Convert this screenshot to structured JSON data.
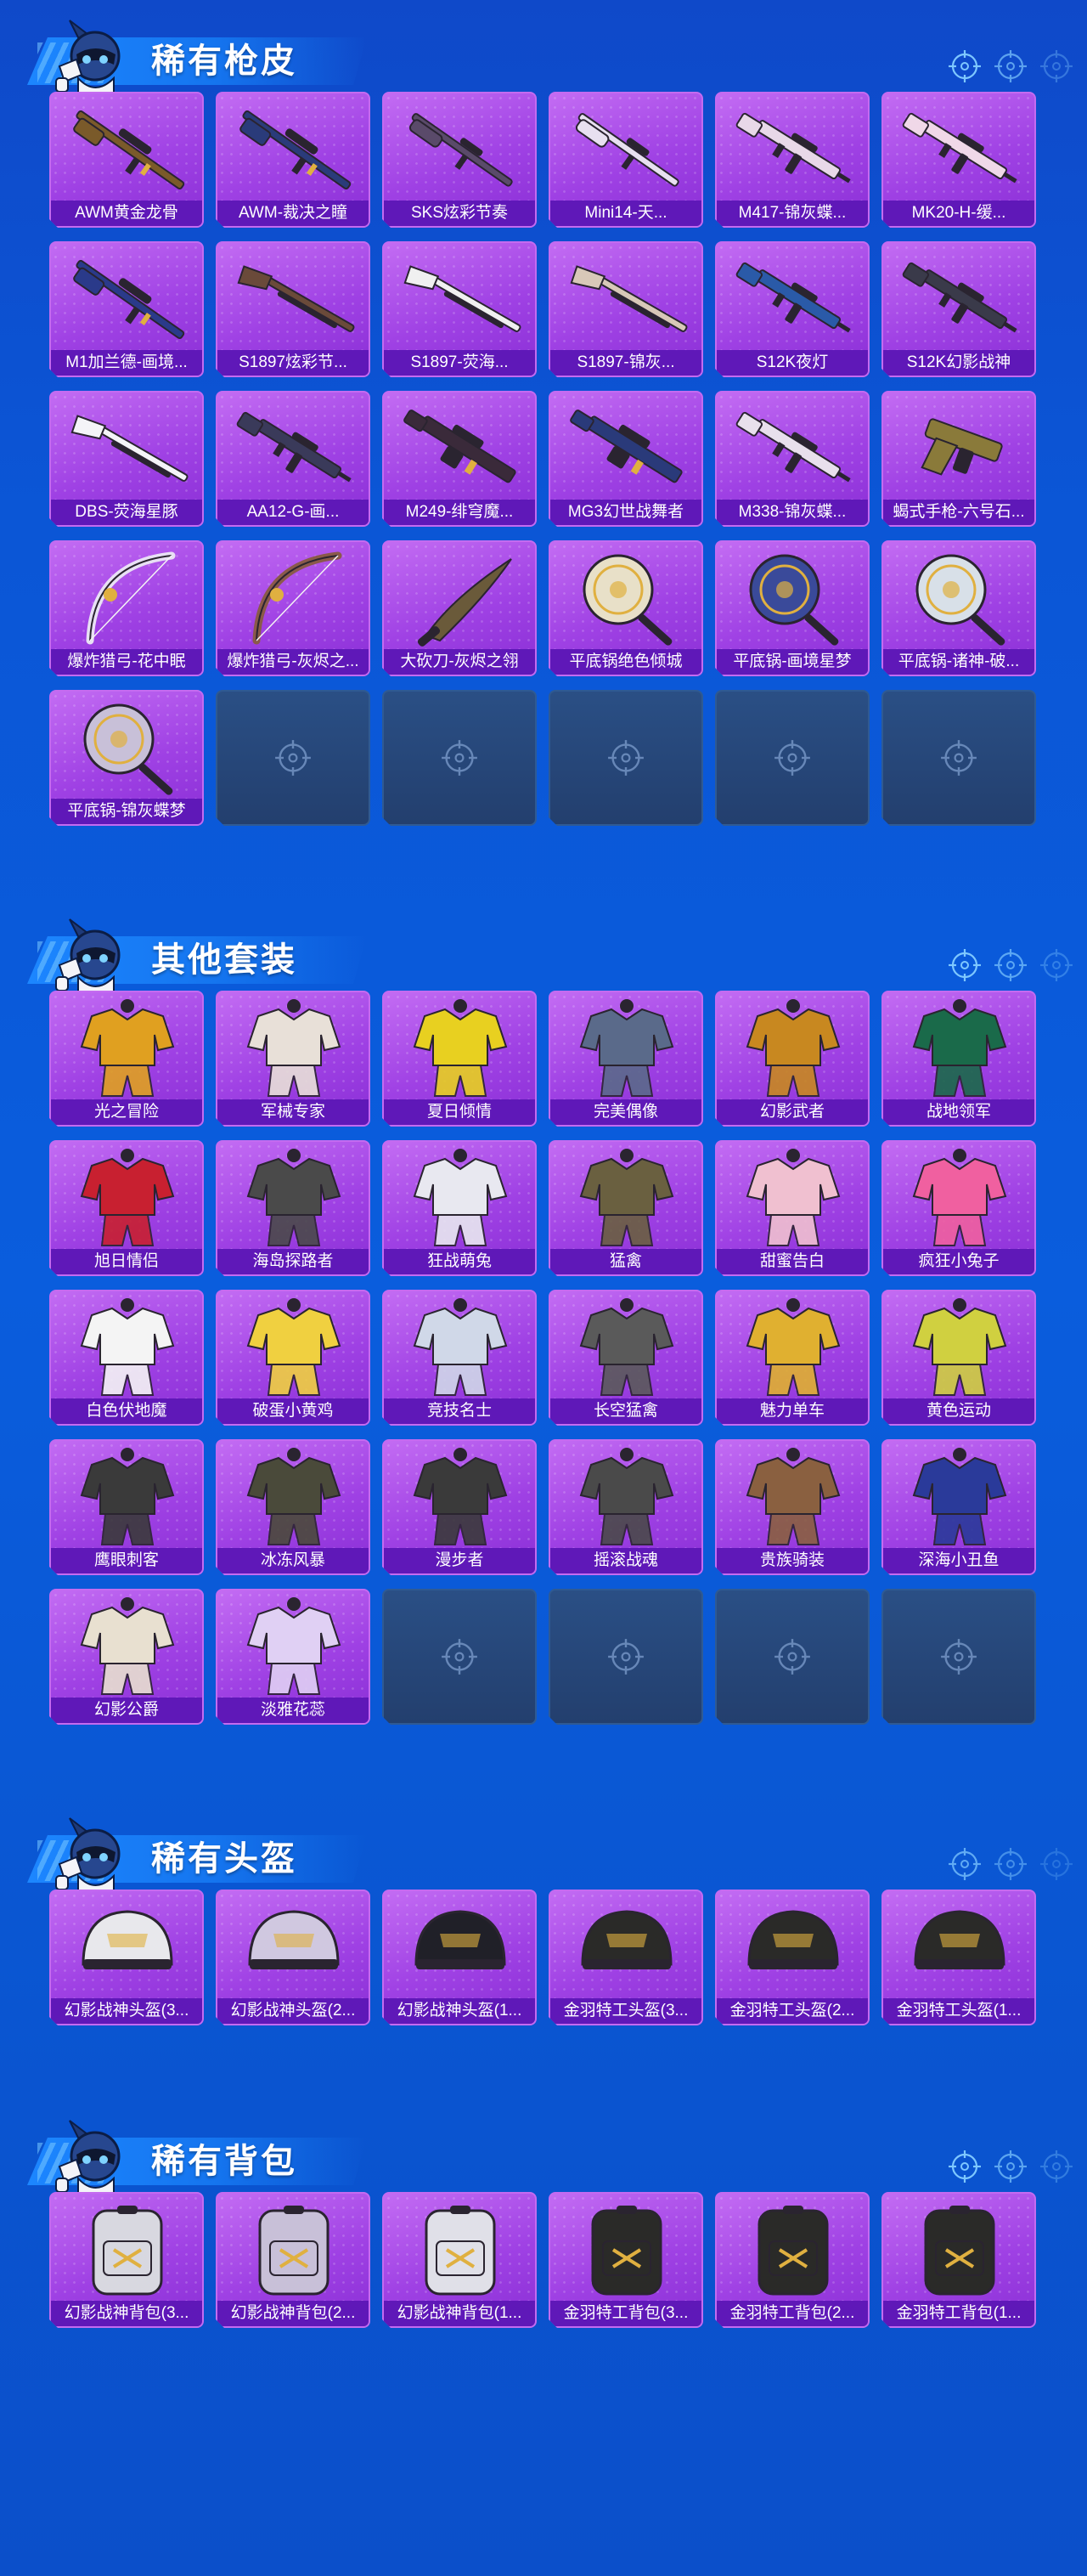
{
  "sections": [
    {
      "title": "稀有枪皮",
      "items": [
        {
          "label": "AWM黄金龙骨",
          "icon": "sniper-rifle",
          "tint": "#7a5a2a"
        },
        {
          "label": "AWM-裁决之瞳",
          "icon": "sniper-rifle",
          "tint": "#2a3b7a"
        },
        {
          "label": "SKS炫彩节奏",
          "icon": "rifle",
          "tint": "#5a4a6a"
        },
        {
          "label": "Mini14-天...",
          "icon": "rifle",
          "tint": "#e8e0f0"
        },
        {
          "label": "M417-锦灰蝶...",
          "icon": "assault-rifle",
          "tint": "#e8d8e8"
        },
        {
          "label": "MK20-H-缓...",
          "icon": "assault-rifle",
          "tint": "#f0d8e8"
        },
        {
          "label": "M1加兰德-画境...",
          "icon": "sniper-rifle",
          "tint": "#2a3a8a"
        },
        {
          "label": "S1897炫彩节...",
          "icon": "shotgun",
          "tint": "#6a4a3a"
        },
        {
          "label": "S1897-荧海...",
          "icon": "shotgun",
          "tint": "#f0f0f0"
        },
        {
          "label": "S1897-锦灰...",
          "icon": "shotgun",
          "tint": "#d8c8b8"
        },
        {
          "label": "S12K夜灯",
          "icon": "assault-rifle",
          "tint": "#2a5aa8"
        },
        {
          "label": "S12K幻影战神",
          "icon": "assault-rifle",
          "tint": "#3a3a4a"
        },
        {
          "label": "DBS-荧海星豚",
          "icon": "shotgun",
          "tint": "#f4f4f8"
        },
        {
          "label": "AA12-G-画...",
          "icon": "assault-rifle",
          "tint": "#3a3a5a"
        },
        {
          "label": "M249-绯穹魔...",
          "icon": "machine-gun",
          "tint": "#3a2a3a"
        },
        {
          "label": "MG3幻世战舞者",
          "icon": "machine-gun",
          "tint": "#2a3a7a"
        },
        {
          "label": "M338-锦灰蝶...",
          "icon": "assault-rifle",
          "tint": "#e8e0ec"
        },
        {
          "label": "蝎式手枪-六号石...",
          "icon": "pistol",
          "tint": "#8a7a3a"
        },
        {
          "label": "爆炸猎弓-花中眠",
          "icon": "bow",
          "tint": "#e8e0f4"
        },
        {
          "label": "爆炸猎弓-灰烬之...",
          "icon": "bow",
          "tint": "#8a5a4a"
        },
        {
          "label": "大砍刀-灰烬之翎",
          "icon": "machete",
          "tint": "#6a5a3a"
        },
        {
          "label": "平底锅绝色倾城",
          "icon": "pan",
          "tint": "#e8e0c8"
        },
        {
          "label": "平底锅-画境星梦",
          "icon": "pan",
          "tint": "#3a4a9a"
        },
        {
          "label": "平底锅-诸神-破...",
          "icon": "pan",
          "tint": "#d8e0e8"
        },
        {
          "label": "平底锅-锦灰蝶梦",
          "icon": "pan",
          "tint": "#c8c0d8"
        }
      ],
      "empty_count": 5
    },
    {
      "title": "其他套装",
      "items": [
        {
          "label": "光之冒险",
          "icon": "outfit",
          "tint": "#e0a020"
        },
        {
          "label": "军械专家",
          "icon": "outfit",
          "tint": "#e8e0d8"
        },
        {
          "label": "夏日倾情",
          "icon": "outfit",
          "tint": "#e8d020"
        },
        {
          "label": "完美偶像",
          "icon": "outfit",
          "tint": "#5a6a8a"
        },
        {
          "label": "幻影武者",
          "icon": "outfit",
          "tint": "#c88820"
        },
        {
          "label": "战地领军",
          "icon": "outfit",
          "tint": "#1a6a4a"
        },
        {
          "label": "旭日情侣",
          "icon": "outfit",
          "tint": "#c82030"
        },
        {
          "label": "海岛探路者",
          "icon": "outfit",
          "tint": "#4a4a4a"
        },
        {
          "label": "狂战萌兔",
          "icon": "outfit",
          "tint": "#e8e8f0"
        },
        {
          "label": "猛禽",
          "icon": "outfit",
          "tint": "#6a6040"
        },
        {
          "label": "甜蜜告白",
          "icon": "outfit",
          "tint": "#f0c0d0"
        },
        {
          "label": "疯狂小兔子",
          "icon": "outfit",
          "tint": "#f060a0"
        },
        {
          "label": "白色伏地魔",
          "icon": "outfit",
          "tint": "#f4f4f4"
        },
        {
          "label": "破蛋小黄鸡",
          "icon": "outfit",
          "tint": "#f0d040"
        },
        {
          "label": "竞技名士",
          "icon": "outfit",
          "tint": "#d0d8e8"
        },
        {
          "label": "长空猛禽",
          "icon": "outfit",
          "tint": "#5a5a5a"
        },
        {
          "label": "魅力单车",
          "icon": "outfit",
          "tint": "#e0b030"
        },
        {
          "label": "黄色运动",
          "icon": "outfit",
          "tint": "#d0d040"
        },
        {
          "label": "鹰眼刺客",
          "icon": "outfit",
          "tint": "#3a3a3a"
        },
        {
          "label": "冰冻风暴",
          "icon": "outfit",
          "tint": "#4a4a3a"
        },
        {
          "label": "漫步者",
          "icon": "outfit",
          "tint": "#3a3a3a"
        },
        {
          "label": "摇滚战魂",
          "icon": "outfit",
          "tint": "#4a4a4a"
        },
        {
          "label": "贵族骑装",
          "icon": "outfit",
          "tint": "#8a6040"
        },
        {
          "label": "深海小丑鱼",
          "icon": "outfit",
          "tint": "#2a3a9a"
        },
        {
          "label": "幻影公爵",
          "icon": "outfit",
          "tint": "#e8e0d0"
        },
        {
          "label": "淡雅花蕊",
          "icon": "outfit",
          "tint": "#e0d0f4"
        }
      ],
      "empty_count": 4
    },
    {
      "title": "稀有头盔",
      "items": [
        {
          "label": "幻影战神头盔(3...",
          "icon": "helmet",
          "tint": "#e8e8ec"
        },
        {
          "label": "幻影战神头盔(2...",
          "icon": "helmet",
          "tint": "#d0c8e0"
        },
        {
          "label": "幻影战神头盔(1...",
          "icon": "helmet",
          "tint": "#202028"
        },
        {
          "label": "金羽特工头盔(3...",
          "icon": "helmet",
          "tint": "#2a2a28"
        },
        {
          "label": "金羽特工头盔(2...",
          "icon": "helmet",
          "tint": "#2a2a28"
        },
        {
          "label": "金羽特工头盔(1...",
          "icon": "helmet",
          "tint": "#2a2a28"
        }
      ],
      "empty_count": 0
    },
    {
      "title": "稀有背包",
      "items": [
        {
          "label": "幻影战神背包(3...",
          "icon": "backpack",
          "tint": "#d8d8e0"
        },
        {
          "label": "幻影战神背包(2...",
          "icon": "backpack",
          "tint": "#c8c0d8"
        },
        {
          "label": "幻影战神背包(1...",
          "icon": "backpack",
          "tint": "#e0e0e8"
        },
        {
          "label": "金羽特工背包(3...",
          "icon": "backpack",
          "tint": "#2a2a28"
        },
        {
          "label": "金羽特工背包(2...",
          "icon": "backpack",
          "tint": "#2a2a28"
        },
        {
          "label": "金羽特工背包(1...",
          "icon": "backpack",
          "tint": "#2a2a28"
        }
      ],
      "empty_count": 0
    }
  ]
}
